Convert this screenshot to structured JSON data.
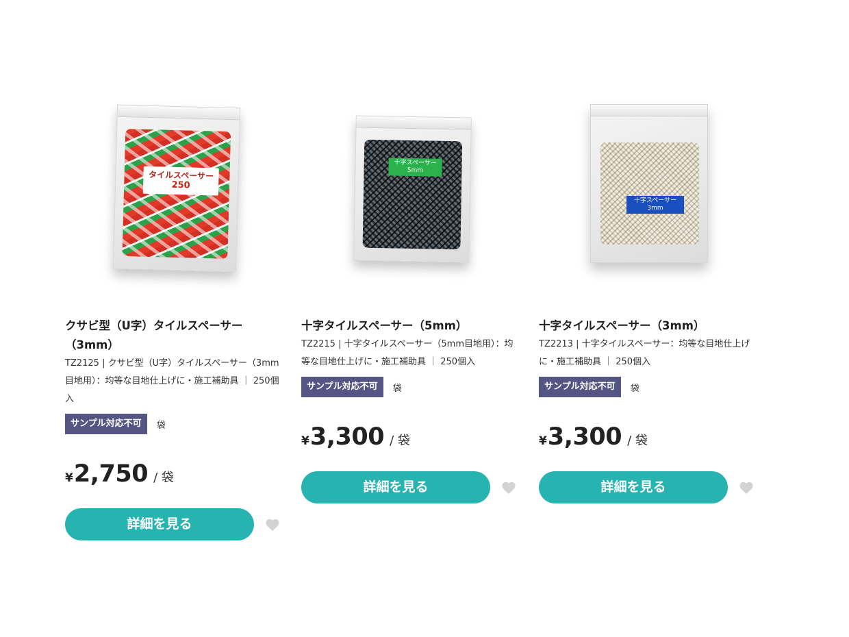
{
  "products": [
    {
      "title": "クサビ型（U字）タイルスペーサー（3mm）",
      "description": "TZ2125 | クサビ型（U字）タイルスペーサー（3mm目地用）：均等な目地仕上げに・施工補助具 ｜ 250個入",
      "badge": "サンプル対応不可",
      "unit_tag": "袋",
      "currency": "¥",
      "price": "2,750",
      "per_unit": "/ 袋",
      "button_label": "詳細を見る",
      "image_label_line1": "タイルスペーサー",
      "image_label_line2": "250",
      "image_colors": [
        "#e23a2a",
        "#2fa04a",
        "#f2f2f2"
      ]
    },
    {
      "title": "十字タイルスペーサー（5mm）",
      "description": "TZ2215 | 十字タイルスペーサー（5mm目地用）：均等な目地仕上げに・施工補助具 ｜ 250個入",
      "badge": "サンプル対応不可",
      "unit_tag": "袋",
      "currency": "¥",
      "price": "3,300",
      "per_unit": "/ 袋",
      "button_label": "詳細を見る",
      "image_label_line1": "十字スペーサー",
      "image_label_line2": "5mm",
      "image_colors": [
        "#3b4044",
        "#2bb24c"
      ]
    },
    {
      "title": "十字タイルスペーサー（3mm）",
      "description": "TZ2213 | 十字タイルスペーサー：均等な目地仕上げに・施工補助具 ｜ 250個入",
      "badge": "サンプル対応不可",
      "unit_tag": "袋",
      "currency": "¥",
      "price": "3,300",
      "per_unit": "/ 袋",
      "button_label": "詳細を見る",
      "image_label_line1": "十字スペーサー",
      "image_label_line2": "3mm",
      "image_colors": [
        "#fbfaf6",
        "#1b4fbf"
      ]
    }
  ],
  "colors": {
    "button": "#27b3b0",
    "badge": "#555583",
    "favorite_icon": "#d3d3d3"
  },
  "icons": {
    "favorite": "heart-icon"
  }
}
